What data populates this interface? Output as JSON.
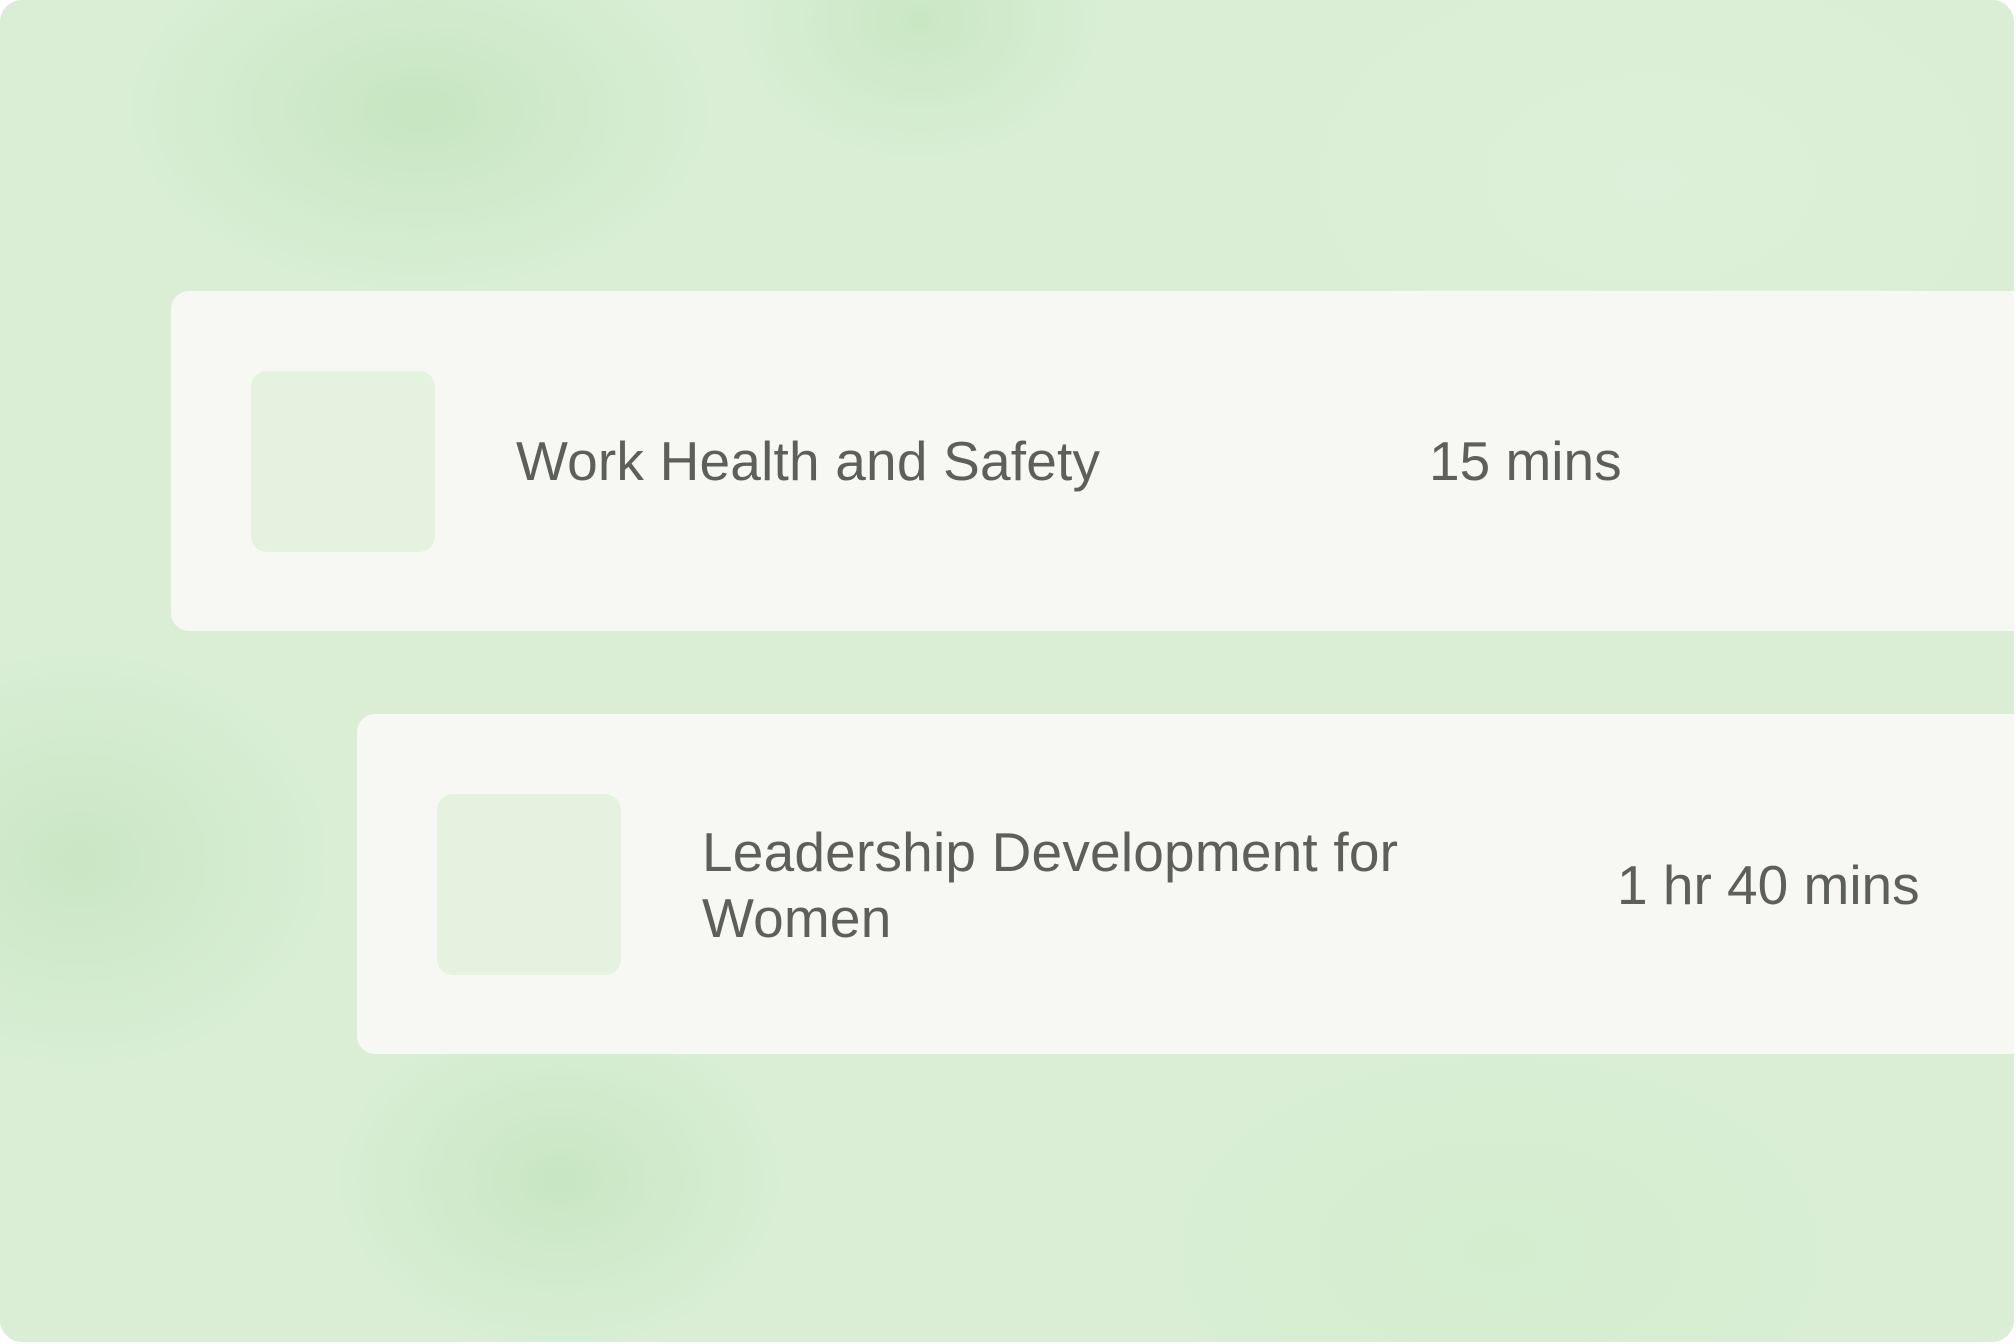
{
  "courses": [
    {
      "title": "Work Health and Safety",
      "duration": "15 mins"
    },
    {
      "title": "Leadership Development for Women",
      "duration": "1 hr 40 mins"
    }
  ],
  "colors": {
    "background": "#d9eed5",
    "card": "#f7f8f3",
    "thumbnail": "#e4f2df",
    "text": "#5c5f5a"
  }
}
